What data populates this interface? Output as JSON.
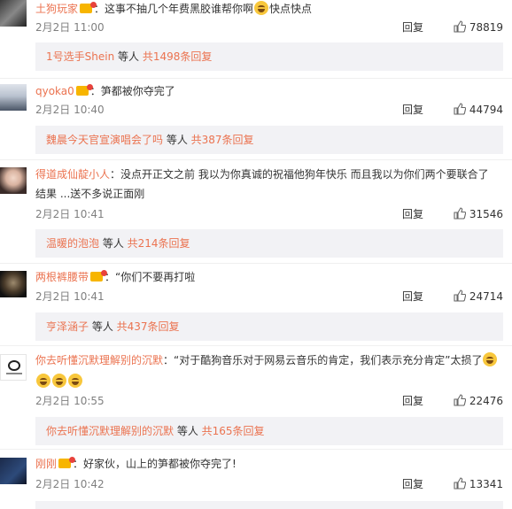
{
  "reply_label": "回复",
  "comments": [
    {
      "user": "土狗玩家",
      "text": "：这事不抽几个年费黑胶谁帮你啊",
      "text_after_emoji": "快点快点",
      "time": "2月2日 11:00",
      "likes": "78819",
      "sub_user": "1号选手Shein",
      "sub_mid": " 等人 ",
      "sub_count": "共1498条回复"
    },
    {
      "user": "qyoka0",
      "text": "：笋都被你夺完了",
      "time": "2月2日 10:40",
      "likes": "44794",
      "sub_user": "魏晨今天官宣演唱会了吗",
      "sub_mid": " 等人 ",
      "sub_count": "共387条回复"
    },
    {
      "user": "得道成仙靛小人",
      "text": "：没点开正文之前 我以为你真诚的祝福他狗年快乐 而且我以为你们两个要联合了",
      "text2": "结果 ...送不多说正面刚",
      "time": "2月2日 10:41",
      "likes": "31546",
      "sub_user": "温暖的泡泡",
      "sub_mid": " 等人 ",
      "sub_count": "共214条回复"
    },
    {
      "user": "两根裤腰带",
      "text": "：“你们不要再打啦",
      "time": "2月2日 10:41",
      "likes": "24714",
      "sub_user": "亨泽涵子",
      "sub_mid": " 等人 ",
      "sub_count": "共437条回复"
    },
    {
      "user": "你去听懂沉默理解别的沉默",
      "text": "：“对于酷狗音乐对于网易云音乐的肯定，我们表示充分肯定”太损了",
      "time": "2月2日 10:55",
      "likes": "22476",
      "sub_user": "你去听懂沉默理解别的沉默",
      "sub_mid": " 等人 ",
      "sub_count": "共165条回复"
    },
    {
      "user": "刚刚",
      "text": "：好家伙，山上的笋都被你夺完了!",
      "time": "2月2日 10:42",
      "likes": "13341"
    }
  ]
}
